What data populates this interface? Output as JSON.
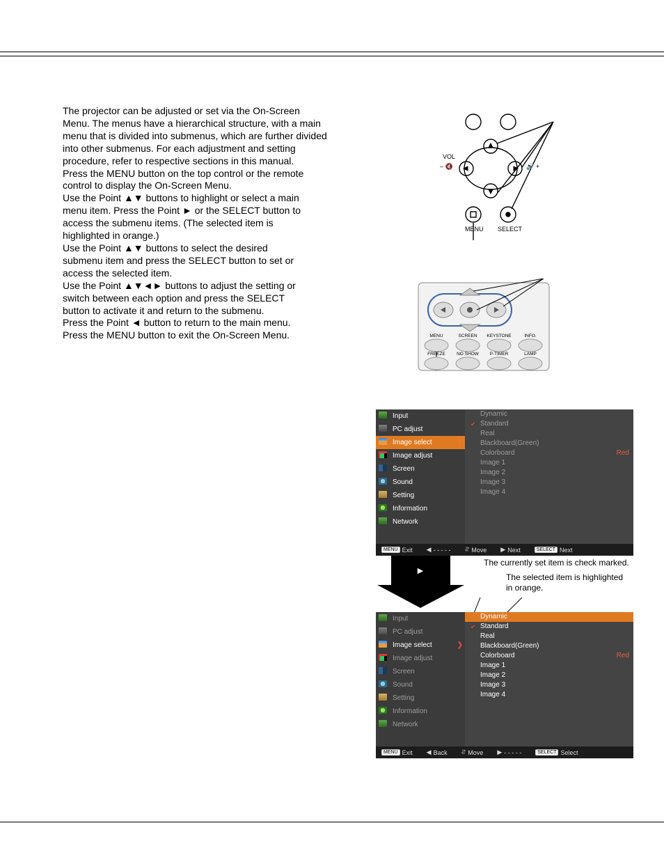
{
  "intro": "The projector can be adjusted or set via the On-Screen Menu. The menus have a hierarchical structure, with a main menu that is divided into submenus, which are further divided into other submenus. For each adjustment and setting procedure, refer to respective sections in this manual.",
  "steps": [
    "Press the MENU button on the top control or the remote control to display the On-Screen Menu.",
    "Use the Point ▲▼ buttons to highlight or select a main menu item. Press the Point ► or the SELECT button to access the submenu items. (The selected item is highlighted in orange.)",
    "Use the Point ▲▼ buttons to select the desired submenu item and press the SELECT button to set or access the selected item.",
    "Use the Point ▲▼◄► buttons to adjust the setting or switch between each option and press the SELECT button to activate it and return to the submenu.",
    "Press the Point ◄ button to return to the main menu. Press the MENU button to exit the On-Screen Menu."
  ],
  "topcontrol": {
    "vol": "VOL",
    "mute_l": "–",
    "mute_r": "+",
    "menu": "MENU",
    "select": "SELECT"
  },
  "remote": {
    "row1": [
      "MENU",
      "SCREEN",
      "KEYSTONE",
      "INFO."
    ],
    "row2": [
      "FREEZE",
      "NO SHOW",
      "P-TIMER",
      "LAMP"
    ]
  },
  "annotations": {
    "checked": "The currently set item is check marked.",
    "selected": "The selected item is highlighted in orange."
  },
  "osd": {
    "main": [
      {
        "icon": "mi-in",
        "label": "Input"
      },
      {
        "icon": "mi-pc",
        "label": "PC adjust"
      },
      {
        "icon": "mi-img",
        "label": "Image select"
      },
      {
        "icon": "mi-adj",
        "label": "Image adjust"
      },
      {
        "icon": "mi-scr",
        "label": "Screen"
      },
      {
        "icon": "mi-snd",
        "label": "Sound"
      },
      {
        "icon": "mi-set",
        "label": "Setting"
      },
      {
        "icon": "mi-inf",
        "label": "Information"
      },
      {
        "icon": "mi-net",
        "label": "Network"
      }
    ],
    "sub": [
      {
        "label": "Dynamic"
      },
      {
        "label": "Standard",
        "checked": true
      },
      {
        "label": "Real"
      },
      {
        "label": "Blackboard(Green)"
      },
      {
        "label": "Colorboard",
        "right": "Red"
      },
      {
        "label": "Image 1"
      },
      {
        "label": "Image 2"
      },
      {
        "label": "Image 3"
      },
      {
        "label": "Image 4"
      }
    ],
    "panel1": {
      "main_sel": 2,
      "sub_sel": -1,
      "arrow_color": "#e87a22",
      "foot": [
        {
          "tag": "MENU",
          "t": "Exit"
        },
        {
          "sym": "◀",
          "t": "- - - - -"
        },
        {
          "sym": "⥯",
          "t": "Move"
        },
        {
          "sym": "▶",
          "t": "Next"
        },
        {
          "tag": "SELECT",
          "t": "Next"
        }
      ]
    },
    "panel2": {
      "main_sel": 2,
      "sub_sel": 0,
      "arrow_color": "#d44",
      "foot": [
        {
          "tag": "MENU",
          "t": "Exit"
        },
        {
          "sym": "◀",
          "t": "Back"
        },
        {
          "sym": "⥯",
          "t": "Move"
        },
        {
          "sym": "▶",
          "t": "- - - - -"
        },
        {
          "tag": "SELECT",
          "t": "Select"
        }
      ]
    }
  },
  "down_arrow_glyph": "►"
}
